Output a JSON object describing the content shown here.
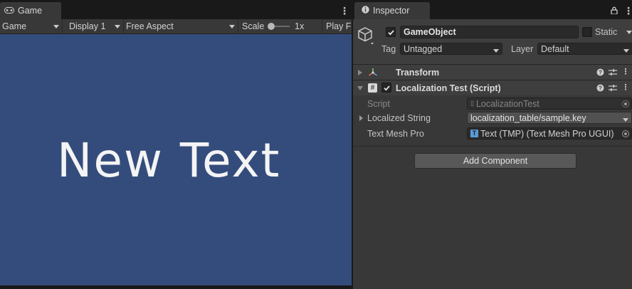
{
  "game_panel": {
    "tab_label": "Game",
    "toolbar": {
      "mode": "Game",
      "display": "Display 1",
      "aspect": "Free Aspect",
      "scale_label": "Scale",
      "scale_value": "1x",
      "play_focus": "Play F"
    },
    "view_text": "New Text",
    "view_bg": "#344c7c"
  },
  "inspector": {
    "tab_label": "Inspector",
    "object_name": "GameObject",
    "static_label": "Static",
    "tag_label": "Tag",
    "tag_value": "Untagged",
    "layer_label": "Layer",
    "layer_value": "Default",
    "components": [
      {
        "name": "Transform"
      },
      {
        "name": "Localization Test (Script)"
      }
    ],
    "script_label": "Script",
    "script_value": "LocalizationTest",
    "localized_label": "Localized String",
    "localized_value": "localization_table/sample.key",
    "tmp_label": "Text Mesh Pro",
    "tmp_value": "Text (TMP) (Text Mesh Pro UGUI)",
    "add_component_label": "Add Component"
  },
  "icons": [
    "gamepad-icon",
    "info-icon",
    "lock-icon",
    "kebab-icon",
    "cube-icon",
    "transform-icon",
    "script-icon",
    "help-icon",
    "presets-icon",
    "object-picker-icon",
    "tmp-icon"
  ]
}
